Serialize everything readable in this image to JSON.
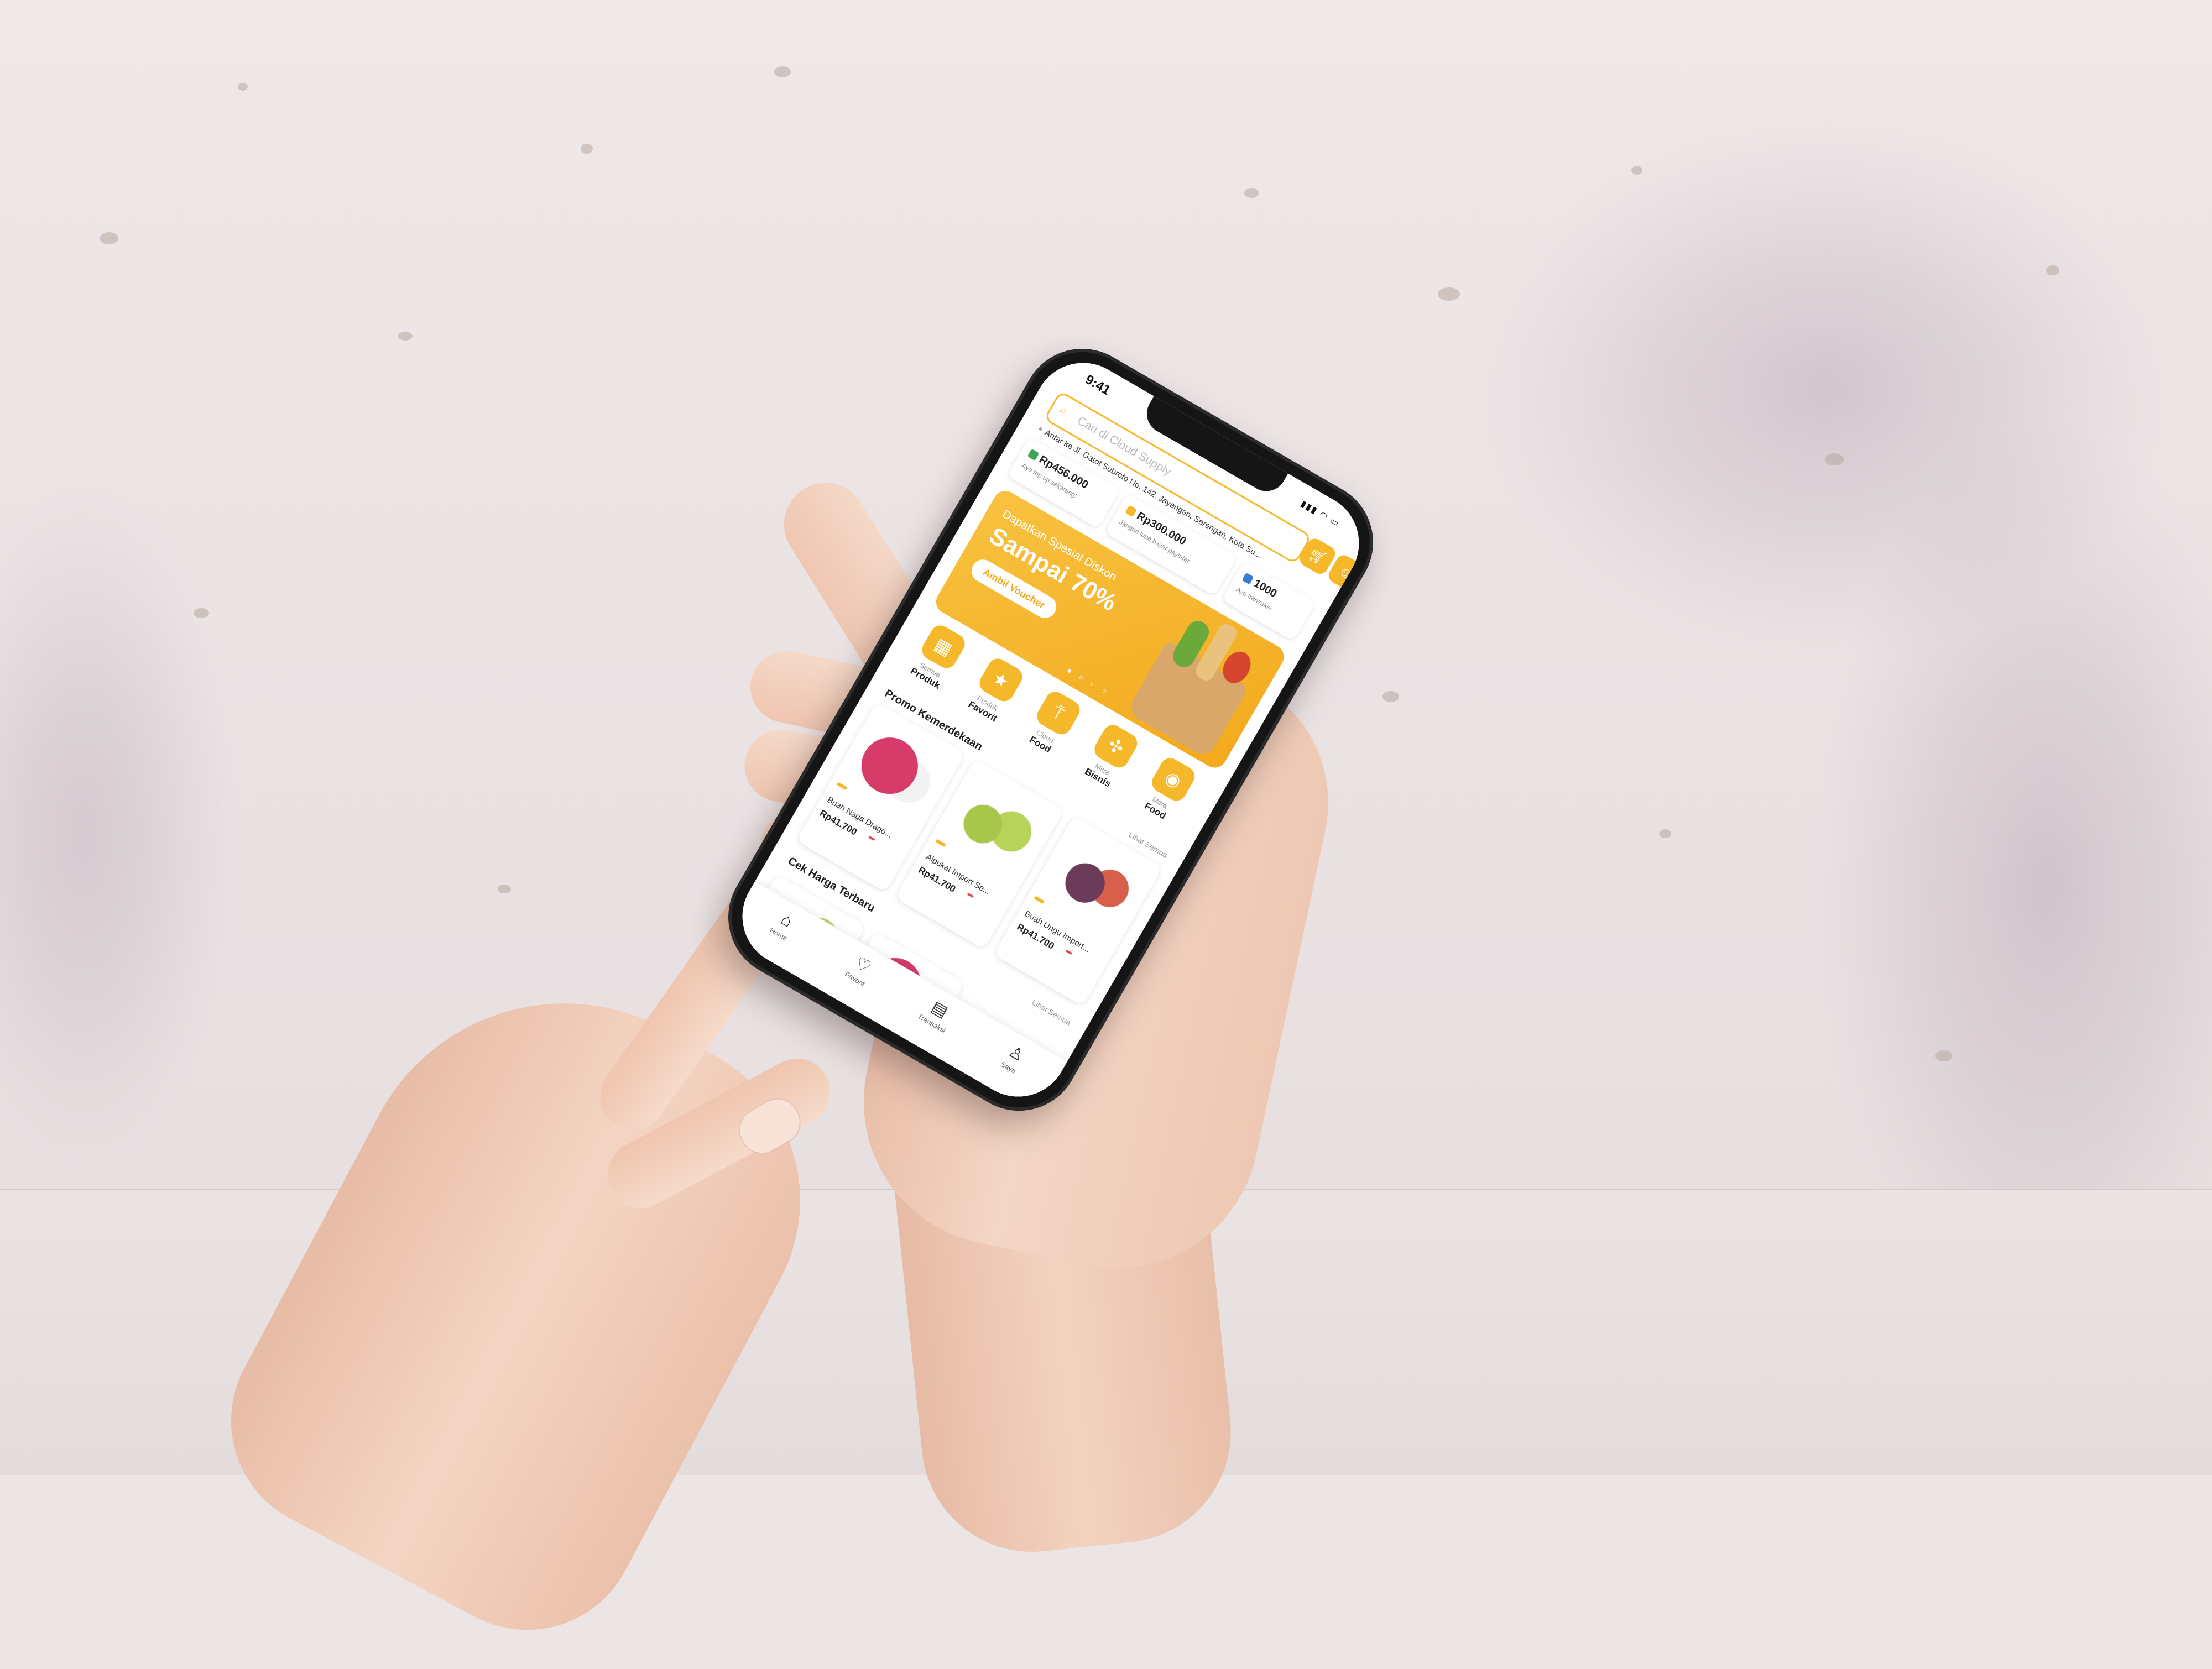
{
  "status_bar": {
    "time": "9:41"
  },
  "search": {
    "placeholder": "Cari di Cloud Supply"
  },
  "address": "Antar ke Jl. Gatot Subroto No. 142, Jayengan, Serengan, Kota Su...",
  "wallet_cards": [
    {
      "amount": "Rp456.000",
      "label": "Ayo top up sekarang!",
      "color": "#3aa655"
    },
    {
      "amount": "Rp300.000",
      "label": "Jangan lupa bayar paylater",
      "color": "#f5b82a"
    },
    {
      "amount": "1000",
      "label": "Ayo transaksi",
      "color": "#3d7bd9"
    }
  ],
  "banner": {
    "line1": "Dapatkan Spesial Diskon",
    "line2": "Sampai 70%",
    "cta": "Ambil Voucher"
  },
  "categories": [
    {
      "top": "Semua",
      "bottom": "Produk",
      "icon": "grid-icon"
    },
    {
      "top": "Produk",
      "bottom": "Favorit",
      "icon": "star-icon"
    },
    {
      "top": "Cloud",
      "bottom": "Food",
      "icon": "cutlery-icon"
    },
    {
      "top": "Mitra",
      "bottom": "Bisnis",
      "icon": "handshake-icon"
    },
    {
      "top": "Mitra",
      "bottom": "Food",
      "icon": "dish-icon"
    }
  ],
  "promo_section": {
    "title": "Promo Kemerdekaan",
    "see_all": "Lihat Semua"
  },
  "products": [
    {
      "name": "Buah Naga Drago...",
      "price": "Rp41.700",
      "image": "dragon-fruit"
    },
    {
      "name": "Alpukat Import Se...",
      "price": "Rp41.700",
      "image": "avocado"
    },
    {
      "name": "Buah Ungu Import...",
      "price": "Rp41.700",
      "image": "fig"
    }
  ],
  "latest_section": {
    "title": "Cek Harga Terbaru",
    "see_all": "Lihat Semua"
  },
  "tabs": [
    {
      "label": "Home",
      "icon": "home-icon",
      "active": true
    },
    {
      "label": "Favorit",
      "icon": "heart-icon",
      "active": false
    },
    {
      "label": "Transaksi",
      "icon": "receipt-icon",
      "active": false
    },
    {
      "label": "Saya",
      "icon": "user-icon",
      "active": false
    }
  ],
  "colors": {
    "accent": "#f5b82a",
    "discount": "#e5484d"
  }
}
